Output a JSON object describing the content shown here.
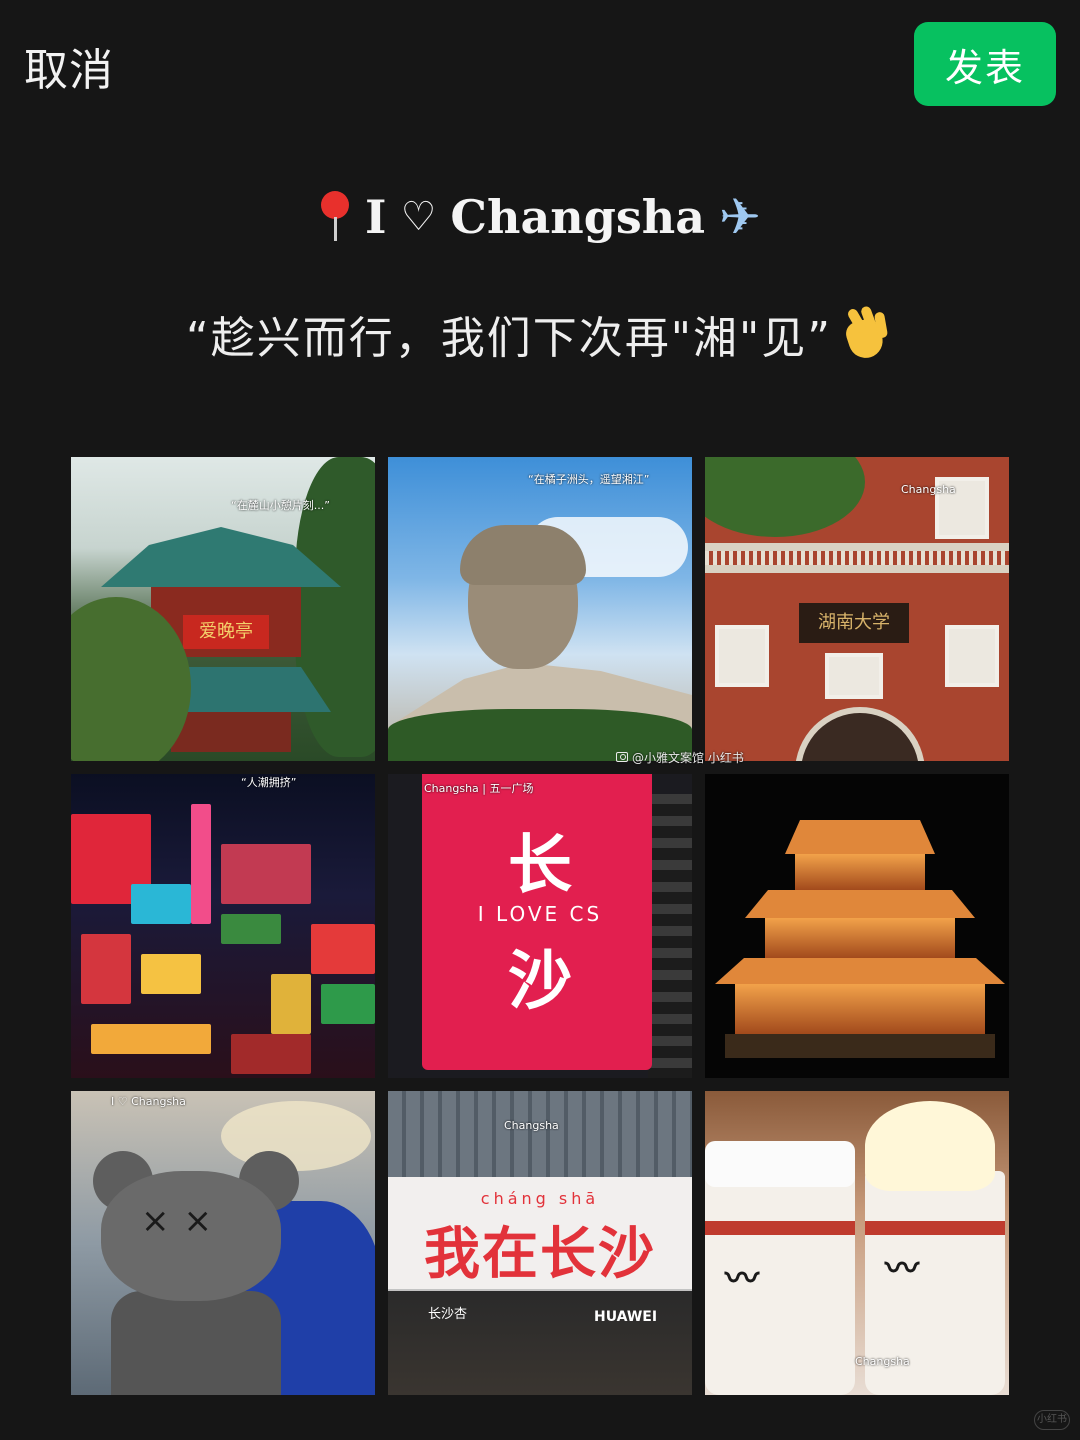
{
  "topbar": {
    "cancel_label": "取消",
    "publish_label": "发表",
    "publish_color": "#07c160"
  },
  "headline": {
    "pin_icon": "round-pushpin-icon",
    "text_i": "I",
    "heart_symbol": "♡",
    "text_city": "Changsha",
    "plane_symbol": "✈",
    "plane_icon": "airplane-icon"
  },
  "quote": {
    "text": "“趁兴而行，我们下次再\"湘\"见”",
    "wave_icon": "waving-hand-icon"
  },
  "photos": [
    {
      "label": "pavilion",
      "plaque": "爱晚亭",
      "caption": "“在麓山小憩片刻...”"
    },
    {
      "label": "statue",
      "caption": "“在橘子洲头，遥望湘江”"
    },
    {
      "label": "brick-building",
      "sign": "湖南大学",
      "caption": "Changsha"
    },
    {
      "label": "neon-street",
      "caption": "“人潮拥挤”"
    },
    {
      "label": "billboard",
      "line1": "长",
      "line2": "I LOVE CS",
      "line3": "沙",
      "caption": "Changsha | 五一广场"
    },
    {
      "label": "lit-tower",
      "caption": ""
    },
    {
      "label": "kaws",
      "caption": "I ♡ Changsha"
    },
    {
      "label": "wo-zai-changsha",
      "pinyin": "cháng shā",
      "big": "我在长沙",
      "shop1": "长沙杏",
      "shop2": "HUAWEI",
      "caption": "Changsha"
    },
    {
      "label": "tea-cups",
      "caption": "Changsha"
    }
  ],
  "credit": {
    "text": "@小雅文案馆 小红书",
    "icon": "camera-icon"
  },
  "watermark": {
    "text": "小红书"
  }
}
